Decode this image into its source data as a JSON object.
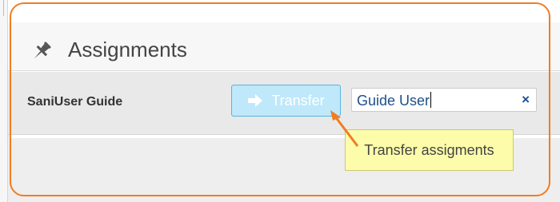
{
  "panel": {
    "title": "Assignments",
    "title_icon": "pushpin-icon"
  },
  "row": {
    "label": "SaniUser Guide",
    "transfer_button": {
      "label": "Transfer",
      "icon": "arrow-right-icon"
    },
    "user_select": {
      "value": "Guide User",
      "clear_icon": "×"
    }
  },
  "tooltip": {
    "text": "Transfer assigments"
  },
  "colors": {
    "highlight": "#f07d24",
    "button_bg": "#bfe8fa",
    "button_border": "#5ab4dc",
    "tooltip_bg": "#fcfcaa",
    "select_text": "#1d4f8c"
  }
}
